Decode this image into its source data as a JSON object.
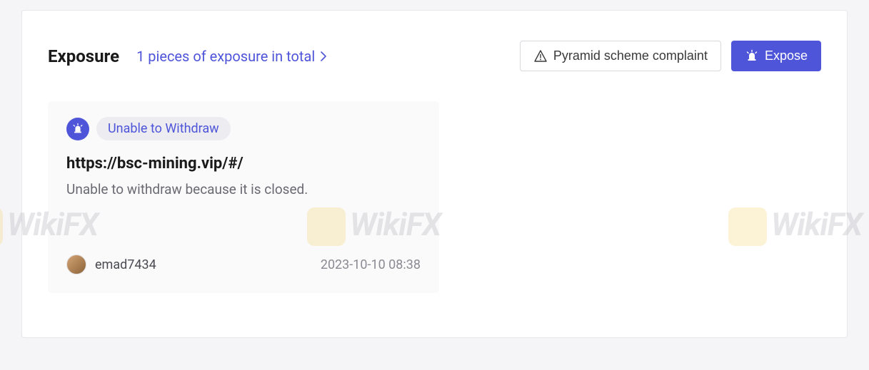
{
  "header": {
    "title": "Exposure",
    "subtitle": "1 pieces of exposure in total",
    "complaint_button": "Pyramid scheme complaint",
    "expose_button": "Expose"
  },
  "exposure": {
    "tag": "Unable to Withdraw",
    "title": "https://bsc-mining.vip/#/",
    "description": "Unable to withdraw because it is closed.",
    "username": "emad7434",
    "timestamp": "2023-10-10 08:38"
  },
  "watermark_text": "WikiFX"
}
